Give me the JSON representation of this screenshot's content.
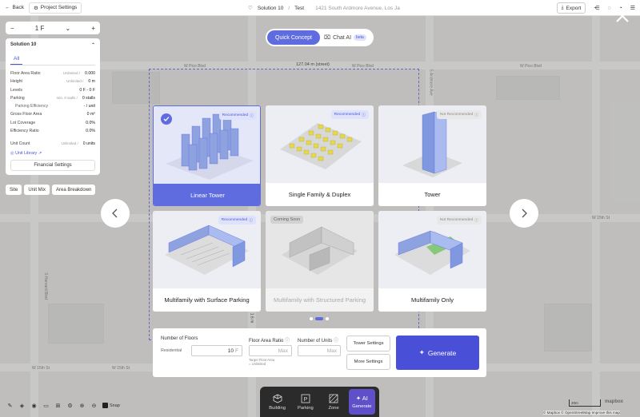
{
  "topbar": {
    "back_label": "Back",
    "project_settings_label": "Project Settings",
    "solution_name": "Solution 10",
    "separator": "/",
    "project_name": "Test",
    "address": "1421 South Ardmore Avenue, Los Ja",
    "export_label": "Export"
  },
  "floor_control": {
    "minus": "−",
    "value": "1 F",
    "plus": "+"
  },
  "solution_panel": {
    "title": "Solution 10",
    "tab_all": "All",
    "rows": [
      {
        "label": "Floor Area Ratio",
        "mid": "Unlimited /",
        "value": "0.000"
      },
      {
        "label": "Height",
        "mid": "Unlimited /",
        "value": "0 m"
      },
      {
        "label": "Levels",
        "mid": "",
        "value": "0 F - 0 F"
      },
      {
        "label": "Parking",
        "mid": "min. 0 stalls /",
        "value": "0 stalls"
      },
      {
        "label": "Parking Efficiency",
        "mid": "",
        "value": "- / unit"
      },
      {
        "label": "Gross Floor Area",
        "mid": "",
        "value": "0 m²"
      },
      {
        "label": "Lot Coverage",
        "mid": "",
        "value": "0.0%"
      },
      {
        "label": "Efficiency Ratio",
        "mid": "",
        "value": "0.0%"
      }
    ],
    "unit_count_label": "Unit Count",
    "unit_count_mid": "Unlimited /",
    "unit_count_value": "0 units",
    "unit_library_label": "Unit Library",
    "financial_settings_label": "Financial Settings"
  },
  "bottom_left_tabs": [
    "Site",
    "Unit Mix",
    "Area Breakdown"
  ],
  "map_labels": {
    "street_1": "W Pico Blvd",
    "street_2": "W 15th St",
    "street_3": "S Ardmore Ave",
    "street_4": "S Harvard Blvd",
    "measure_top": "127.04 m (street)",
    "measure_side": "1.6 m"
  },
  "mode_toggle": {
    "quick_concept": "Quick Concept",
    "chat_ai": "Chat AI",
    "beta": "beta"
  },
  "cards": [
    {
      "title": "Linear Tower",
      "badge": "Recommended",
      "state": "selected"
    },
    {
      "title": "Single Family & Duplex",
      "badge": "Recommended",
      "state": "normal"
    },
    {
      "title": "Tower",
      "badge": "Not Recommended",
      "state": "normal"
    },
    {
      "title": "Multifamily with Surface Parking",
      "badge": "Recommended",
      "state": "normal"
    },
    {
      "title": "Multifamily with Structured Parking",
      "badge": "Coming Soon",
      "state": "disabled"
    },
    {
      "title": "Multifamily Only",
      "badge": "Not Recommended",
      "state": "normal"
    }
  ],
  "generate_panel": {
    "floors_label": "Number of Floors",
    "residential_label": "Residential",
    "floors_value": "10",
    "floors_unit": "F",
    "far_label": "Floor Area Ratio",
    "far_placeholder": "Max",
    "far_note_1": "Target Floor Area",
    "far_note_2": "= Unlimited",
    "units_label": "Number of Units",
    "units_placeholder": "Max",
    "tower_settings_label": "Tower Settings",
    "more_settings_label": "More Settings",
    "generate_label": "Generate"
  },
  "bottom_tabs": [
    {
      "label": "Building",
      "active": false
    },
    {
      "label": "Parking",
      "active": false
    },
    {
      "label": "Zone",
      "active": false
    },
    {
      "label": "Generate",
      "active": true
    }
  ],
  "bottom_tools": {
    "snap_label": "Snap"
  },
  "map_footer": {
    "scale_label": "20m",
    "mapbox_logo": "mapbox",
    "attribution": "© Mapbox © OpenStreetMap Improve this map"
  }
}
